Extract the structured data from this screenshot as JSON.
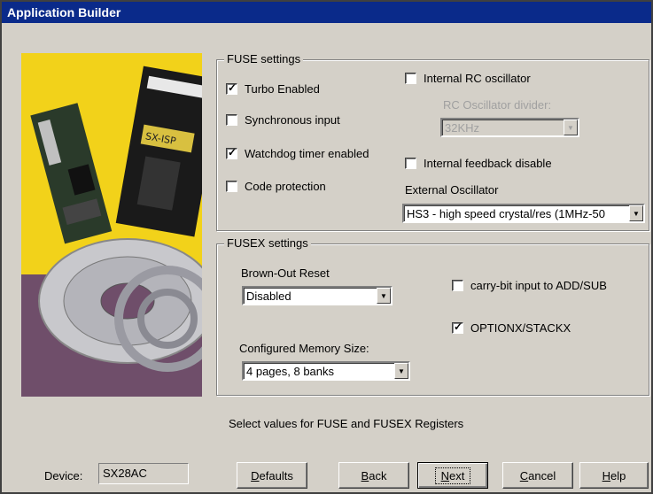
{
  "window": {
    "title": "Application Builder"
  },
  "fuse": {
    "title": "FUSE settings",
    "turbo": {
      "label": "Turbo Enabled",
      "checked": true
    },
    "sync_input": {
      "label": "Synchronous input",
      "checked": false
    },
    "watchdog": {
      "label": "Watchdog timer enabled",
      "checked": true
    },
    "code_protection": {
      "label": "Code protection",
      "checked": false
    },
    "internal_rc": {
      "label": "Internal RC oscillator",
      "checked": false
    },
    "rc_divider": {
      "label": "RC Oscillator divider:",
      "value": "32KHz",
      "enabled": false
    },
    "internal_feedback": {
      "label": "Internal feedback disable",
      "checked": false
    },
    "external_osc": {
      "label": "External Oscillator",
      "value": "HS3 - high speed crystal/res (1MHz-50"
    }
  },
  "fusex": {
    "title": "FUSEX settings",
    "brown_out": {
      "label": "Brown-Out Reset",
      "value": "Disabled"
    },
    "memory": {
      "label": "Configured Memory Size:",
      "value": "4 pages, 8 banks"
    },
    "carry_bit": {
      "label": "carry-bit input to ADD/SUB",
      "checked": false
    },
    "optionx": {
      "label": "OPTIONX/STACKX",
      "checked": true
    }
  },
  "status": "Select values for FUSE and FUSEX Registers",
  "device": {
    "label": "Device:",
    "value": "SX28AC"
  },
  "buttons": {
    "defaults": {
      "u": "D",
      "rest": "efaults"
    },
    "back": {
      "u": "B",
      "rest": "ack"
    },
    "next": {
      "u": "N",
      "rest": "ext"
    },
    "cancel": {
      "u": "C",
      "rest": "ancel"
    },
    "help": {
      "u": "H",
      "rest": "elp"
    }
  },
  "picture": {
    "sticker": "SX-ISP"
  }
}
